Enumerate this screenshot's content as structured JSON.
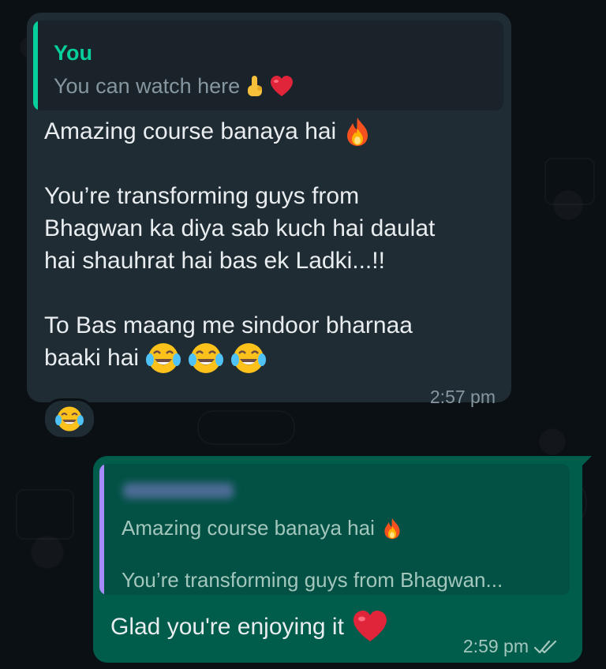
{
  "incoming": {
    "quote": {
      "author": "You",
      "text": "You can watch here"
    },
    "lines": [
      "Amazing course banaya hai",
      "",
      "You’re transforming guys from",
      "Bhagwan ka diya sab kuch hai daulat",
      "hai shauhrat hai bas ek Ladki...!!",
      "",
      "To Bas maang me sindoor bharnaa",
      "baaki hai"
    ],
    "time": "2:57 pm",
    "reaction": "laughing-tears-emoji"
  },
  "outgoing": {
    "quote": {
      "line1": "Amazing course banaya hai",
      "line2": "You’re transforming guys from Bhagwan..."
    },
    "text": "Glad you're enjoying it",
    "time": "2:59 pm",
    "status": "read-double-check"
  },
  "colors": {
    "background": "#0b1014",
    "incoming_bubble": "#1f2c34",
    "outgoing_bubble": "#005c4b",
    "quote_author": "#06cf9c",
    "reply_bar_out": "#a78bfa"
  }
}
